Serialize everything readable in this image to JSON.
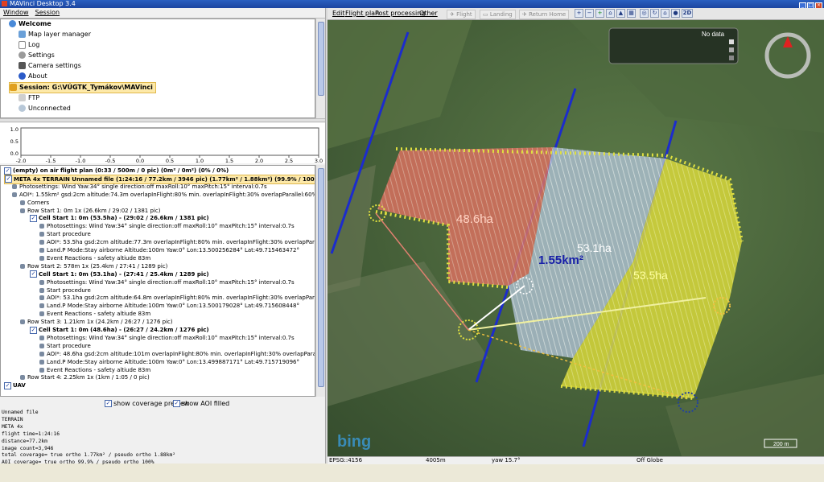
{
  "window": {
    "title": "MAVinci Desktop 3.4"
  },
  "menubar": {
    "items": [
      "Window",
      "Session"
    ]
  },
  "session_tree": {
    "items": [
      {
        "label": "Welcome",
        "icon": "welcome-icon",
        "bold": true
      },
      {
        "label": "Map layer manager",
        "icon": "layers-icon"
      },
      {
        "label": "Log",
        "icon": "log-icon"
      },
      {
        "label": "Settings",
        "icon": "gear-icon"
      },
      {
        "label": "Camera settings",
        "icon": "camera-icon"
      },
      {
        "label": "About",
        "icon": "info-icon"
      },
      {
        "label": "Session: G:\\VÚGTK_Tymákov\\MAVinci",
        "icon": "plane-icon",
        "bold": true,
        "highlight": true
      },
      {
        "label": "FTP",
        "icon": "ftp-icon"
      },
      {
        "label": "Unconnected",
        "icon": "connection-icon"
      }
    ]
  },
  "elevation_chart": {
    "chart_data": {
      "type": "line",
      "x_ticks": [
        "-2.0",
        "-1.5",
        "-1.0",
        "-0.5",
        "0.0",
        "0.5",
        "1.0",
        "1.5",
        "2.0",
        "2.5",
        "3.0"
      ],
      "y_ticks": [
        "1.0",
        "0.5",
        "0.0"
      ],
      "series": []
    }
  },
  "plan_tree": {
    "rows": [
      {
        "level": 0,
        "text": "(empty) on air flight plan (0:33 / 500m / 0 pic) (0m² / 0m²) (0% / 0%)",
        "bold": true,
        "checkbox": true
      },
      {
        "level": 0,
        "text": "META 4x TERRAIN Unnamed file (1:24:16 / 77.2km / 3946 pic) (1.77km² / 1.88km²) (99.9% / 100%)",
        "bold": true,
        "checkbox": true,
        "highlight": true
      },
      {
        "level": 1,
        "text": "Photosettings: Wind Yaw:34° single direction:off maxRoll:10° maxPitch:15° interval:0.7s"
      },
      {
        "level": 1,
        "text": "AOI*: 1.55km² gsd:2cm altitude:74.3m overlapInFlight:80% min. overlapInFlight:30% overlapParallel:60%"
      },
      {
        "level": 2,
        "text": "Corners"
      },
      {
        "level": 2,
        "text": "Row Start 1: 0m 1x (26.6km / 29:02 / 1381 pic)"
      },
      {
        "level": 3,
        "text": "Cell Start 1: 0m (53.5ha) - (29:02 / 26.6km / 1381 pic)",
        "bold": true,
        "checkbox": true
      },
      {
        "level": 4,
        "text": "Photosettings: Wind Yaw:34° single direction:off maxRoll:10° maxPitch:15° interval:0.7s"
      },
      {
        "level": 4,
        "text": "Start procedure"
      },
      {
        "level": 4,
        "text": "AOI*: 53.5ha gsd:2cm altitude:77.3m overlapInFlight:80% min. overlapInFlight:30% overlapParallel:60%"
      },
      {
        "level": 4,
        "text": "Land.P Mode:Stay airborne Altitude:100m Yaw:0° Lon:13.500256284° Lat:49.715463472°"
      },
      {
        "level": 4,
        "text": "Event Reactions - safety altiude 83m"
      },
      {
        "level": 2,
        "text": "Row Start 2: 578m 1x (25.4km / 27:41 / 1289 pic)"
      },
      {
        "level": 3,
        "text": "Cell Start 1: 0m (53.1ha) - (27:41 / 25.4km / 1289 pic)",
        "bold": true,
        "checkbox": true
      },
      {
        "level": 4,
        "text": "Photosettings: Wind Yaw:34° single direction:off maxRoll:10° maxPitch:15° interval:0.7s"
      },
      {
        "level": 4,
        "text": "Start procedure"
      },
      {
        "level": 4,
        "text": "AOI*: 53.1ha gsd:2cm altitude:64.8m overlapInFlight:80% min. overlapInFlight:30% overlapParallel:60%"
      },
      {
        "level": 4,
        "text": "Land.P Mode:Stay airborne Altitude:100m Yaw:0° Lon:13.500179028° Lat:49.715608448°"
      },
      {
        "level": 4,
        "text": "Event Reactions - safety altiude 83m"
      },
      {
        "level": 2,
        "text": "Row Start 3: 1.21km 1x (24.2km / 26:27 / 1276 pic)"
      },
      {
        "level": 3,
        "text": "Cell Start 1: 0m (48.6ha) - (26:27 / 24.2km / 1276 pic)",
        "bold": true,
        "checkbox": true
      },
      {
        "level": 4,
        "text": "Photosettings: Wind Yaw:34° single direction:off maxRoll:10° maxPitch:15° interval:0.7s"
      },
      {
        "level": 4,
        "text": "Start procedure"
      },
      {
        "level": 4,
        "text": "AOI*: 48.6ha gsd:2cm altitude:101m overlapInFlight:80% min. overlapInFlight:30% overlapParallel:60%"
      },
      {
        "level": 4,
        "text": "Land.P Mode:Stay airborne Altitude:100m Yaw:0° Lon:13.499887171° Lat:49.715719096°"
      },
      {
        "level": 4,
        "text": "Event Reactions - safety altiude 83m"
      },
      {
        "level": 2,
        "text": "Row Start 4: 2.25km 1x (1km / 1:05 / 0 pic)"
      },
      {
        "level": 0,
        "text": "UAV",
        "bold": true,
        "checkbox": true
      }
    ]
  },
  "options": {
    "show_coverage_preview": "show coverage preview",
    "show_aoi_filled": "show AOI filled"
  },
  "summary": {
    "lines": [
      "Unnamed file",
      "TERRAIN",
      "META 4x",
      "flight time=1:24:16",
      "distance=77.2km",
      "image count=3,946",
      "total coverage= true ortho 1.77km² / pseudo ortho 1.88km²",
      "AOI coverage= true ortho 99.9% / pseudo ortho 100%"
    ]
  },
  "map_toolbar": {
    "menus": [
      "Edit",
      "Flight plan",
      "Post processing",
      "Other"
    ],
    "buttons": [
      "Flight",
      "Landing",
      "Return Home"
    ],
    "view_2d": "2D"
  },
  "map": {
    "nodata_label": "No data",
    "area_labels": [
      "48.6ha",
      "53.1ha",
      "1.55km²",
      "53.5ha"
    ],
    "area_colors": [
      "#e06a5a",
      "#c8d8e8",
      "#e8e840"
    ],
    "scale_label": "200 m",
    "bing_logo": "bing"
  },
  "status": {
    "projection": "EPSG::4156",
    "altitude": "4005m",
    "yaw": "yaw 15.7°",
    "globe": "Off Globe"
  }
}
